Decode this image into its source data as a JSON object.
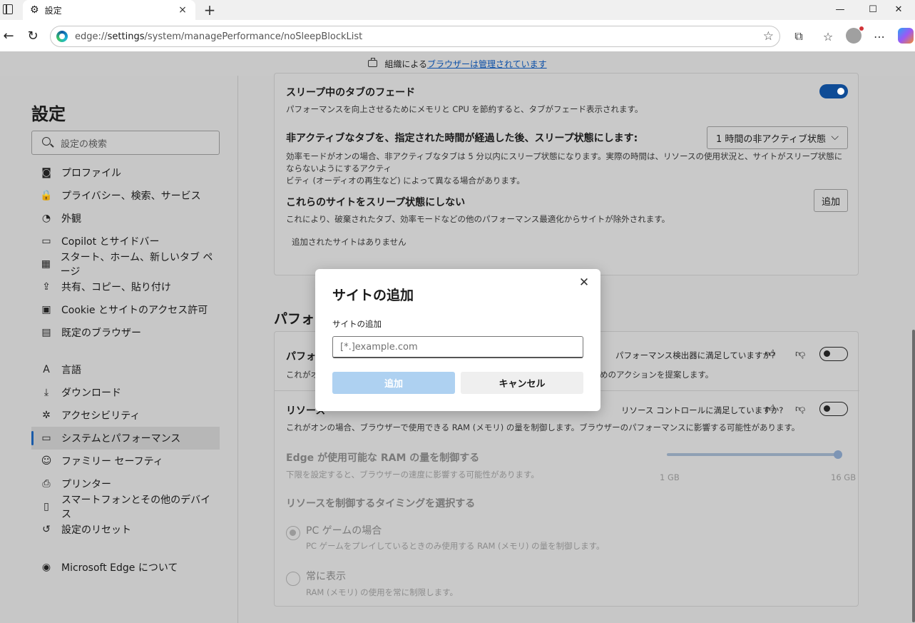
{
  "tab": {
    "title": "設定",
    "new_tab": "+",
    "close": "×"
  },
  "window": {
    "minimize": "—",
    "maximize": "☐",
    "close": "✕"
  },
  "address": {
    "prefix": "edge://",
    "host": "settings",
    "path": "/system/managePerformance/noSleepBlockList"
  },
  "managed_bar": {
    "text": "組織による",
    "link": "ブラウザーは管理されています"
  },
  "sidebar": {
    "title": "設定",
    "search_placeholder": "設定の検索",
    "items": [
      {
        "label": "プロファイル",
        "icon": "profile-icon",
        "glyph": "◙"
      },
      {
        "label": "プライバシー、検索、サービス",
        "icon": "lock-icon",
        "glyph": "🔒"
      },
      {
        "label": "外観",
        "icon": "palette-icon",
        "glyph": "◔"
      },
      {
        "label": "Copilot とサイドバー",
        "icon": "sidebar-icon",
        "glyph": "▭"
      },
      {
        "label": "スタート、ホーム、新しいタブ ページ",
        "icon": "start-icon",
        "glyph": "▦"
      },
      {
        "label": "共有、コピー、貼り付け",
        "icon": "share-icon",
        "glyph": "⇪"
      },
      {
        "label": "Cookie とサイトのアクセス許可",
        "icon": "cookie-icon",
        "glyph": "▣"
      },
      {
        "label": "既定のブラウザー",
        "icon": "browser-icon",
        "glyph": "▤"
      },
      {
        "label": "言語",
        "icon": "language-icon",
        "glyph": "A"
      },
      {
        "label": "ダウンロード",
        "icon": "download-icon",
        "glyph": "⤓"
      },
      {
        "label": "アクセシビリティ",
        "icon": "accessibility-icon",
        "glyph": "✲"
      },
      {
        "label": "システムとパフォーマンス",
        "icon": "system-icon",
        "glyph": "▭"
      },
      {
        "label": "ファミリー セーフティ",
        "icon": "family-icon",
        "glyph": "☺"
      },
      {
        "label": "プリンター",
        "icon": "printer-icon",
        "glyph": "⎙"
      },
      {
        "label": "スマートフォンとその他のデバイス",
        "icon": "phone-icon",
        "glyph": "▯"
      },
      {
        "label": "設定のリセット",
        "icon": "reset-icon",
        "glyph": "↺"
      },
      {
        "label": "Microsoft Edge について",
        "icon": "edge-icon",
        "glyph": "◉"
      }
    ]
  },
  "card1": {
    "fade_title": "スリープ中のタブのフェード",
    "fade_desc": "パフォーマンスを向上させるためにメモリと CPU を節約すると、タブがフェード表示されます。",
    "fade_toggle_on": true,
    "sleep_title": "非アクティブなタブを、指定された時間が経過した後、スリープ状態にします:",
    "sleep_select": "1 時間の非アクティブ状態",
    "sleep_desc_1": "効率モードがオンの場合、非アクティブなタブは 5 分以内にスリープ状態になります。実際の時間は、リソースの使用状況と、サイトがスリープ状態にならないようにするアクティ",
    "sleep_desc_2": "ビティ (オーディオの再生など) によって異なる場合があります。",
    "nosleep_title": "これらのサイトをスリープ状態にしない",
    "nosleep_add": "追加",
    "nosleep_desc": "これにより、破棄されたタブ、効率モードなどの他のパフォーマンス最適化からサイトが除外されます。",
    "nosleep_empty": "追加されたサイトはありません"
  },
  "section2": {
    "heading": "パフォー",
    "row1_title": "パフォー",
    "row1_feedback": "パフォーマンス検出器に満足していますか?",
    "row1_desc_left": "これがオン",
    "row1_desc_right": "めのアクションを提案します。",
    "row2_title": "リソース",
    "row2_feedback": "リソース コントロールに満足していますか?",
    "row2_desc": "これがオンの場合、ブラウザーで使用できる RAM (メモリ) の量を制御します。ブラウザーのパフォーマンスに影響する可能性があります。",
    "ram_title": "Edge が使用可能な RAM の量を制御する",
    "ram_desc": "下限を設定すると、ブラウザーの速度に影響する可能性があります。",
    "ram_min": "1 GB",
    "ram_max": "16 GB",
    "ram_level": 1.0,
    "timing_title": "リソースを制御するタイミングを選択する",
    "opt1_title": "PC ゲームの場合",
    "opt1_desc": "PC ゲームをプレイしているときのみ使用する RAM (メモリ) の量を制御します。",
    "opt2_title": "常に表示",
    "opt2_desc": "RAM (メモリ) の使用を常に制限します。"
  },
  "modal": {
    "title": "サイトの追加",
    "label": "サイトの追加",
    "placeholder": "[*.]example.com",
    "value": "",
    "add": "追加",
    "cancel": "キャンセル",
    "close": "✕"
  },
  "colors": {
    "accent": "#0f4c96",
    "primary_disabled": "#aed1f1",
    "overlay": "#c7c7c7"
  }
}
